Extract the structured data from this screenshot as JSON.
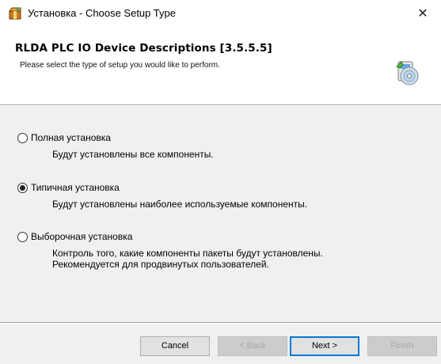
{
  "window": {
    "title": "Установка - Choose Setup Type",
    "close_glyph": "✕"
  },
  "header": {
    "heading": "RLDA PLC IO Device Descriptions [3.5.5.5]",
    "subheading": "Please select the type of setup you would like to perform."
  },
  "options": [
    {
      "label": "Полная установка",
      "description": [
        "Будут установлены все компоненты."
      ],
      "selected": false
    },
    {
      "label": "Типичная установка",
      "description": [
        "Будут установлены наиболее используемые компоненты."
      ],
      "selected": true
    },
    {
      "label": "Выборочная установка",
      "description": [
        "Контроль того, какие компоненты пакеты будут установлены.",
        "Рекомендуется для продвинутых пользователей."
      ],
      "selected": false
    }
  ],
  "buttons": {
    "cancel": "Cancel",
    "back": "< Back",
    "next": "Next >",
    "finish": "Finish"
  },
  "colors": {
    "accent": "#0078d7",
    "background": "#f0f0f0",
    "header_background": "#ffffff"
  },
  "icons": {
    "app": "installer-package-icon",
    "setup": "setup-disc-icon",
    "close": "close-icon"
  }
}
